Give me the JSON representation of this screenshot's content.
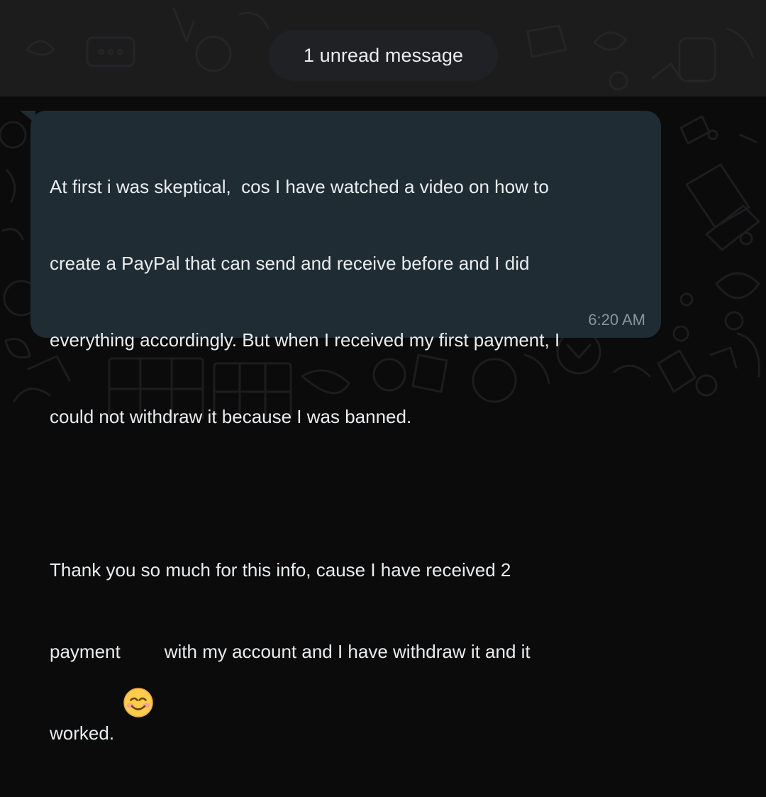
{
  "banner": {
    "text": "1 unread message"
  },
  "message": {
    "paragraph1": [
      "At first i was skeptical,  cos I have watched a video on how to",
      "create a PayPal that can send and receive before and I did",
      "everything accordingly. But when I received my first payment, I",
      "could not withdraw it because I was banned."
    ],
    "paragraph2_line1": "Thank you so much for this info, cause I have received 2",
    "paragraph2_before_emoji": "payment",
    "emoji": "smiling-face-icon",
    "paragraph2_after_emoji": "with my account and I have withdraw it and it",
    "paragraph2_last": "worked.",
    "time": "6:20 AM"
  },
  "colors": {
    "background": "#0b0b0b",
    "bubble": "#202c33",
    "text": "#e9edef",
    "timestamp": "#8696a0",
    "pill": "#202124"
  }
}
